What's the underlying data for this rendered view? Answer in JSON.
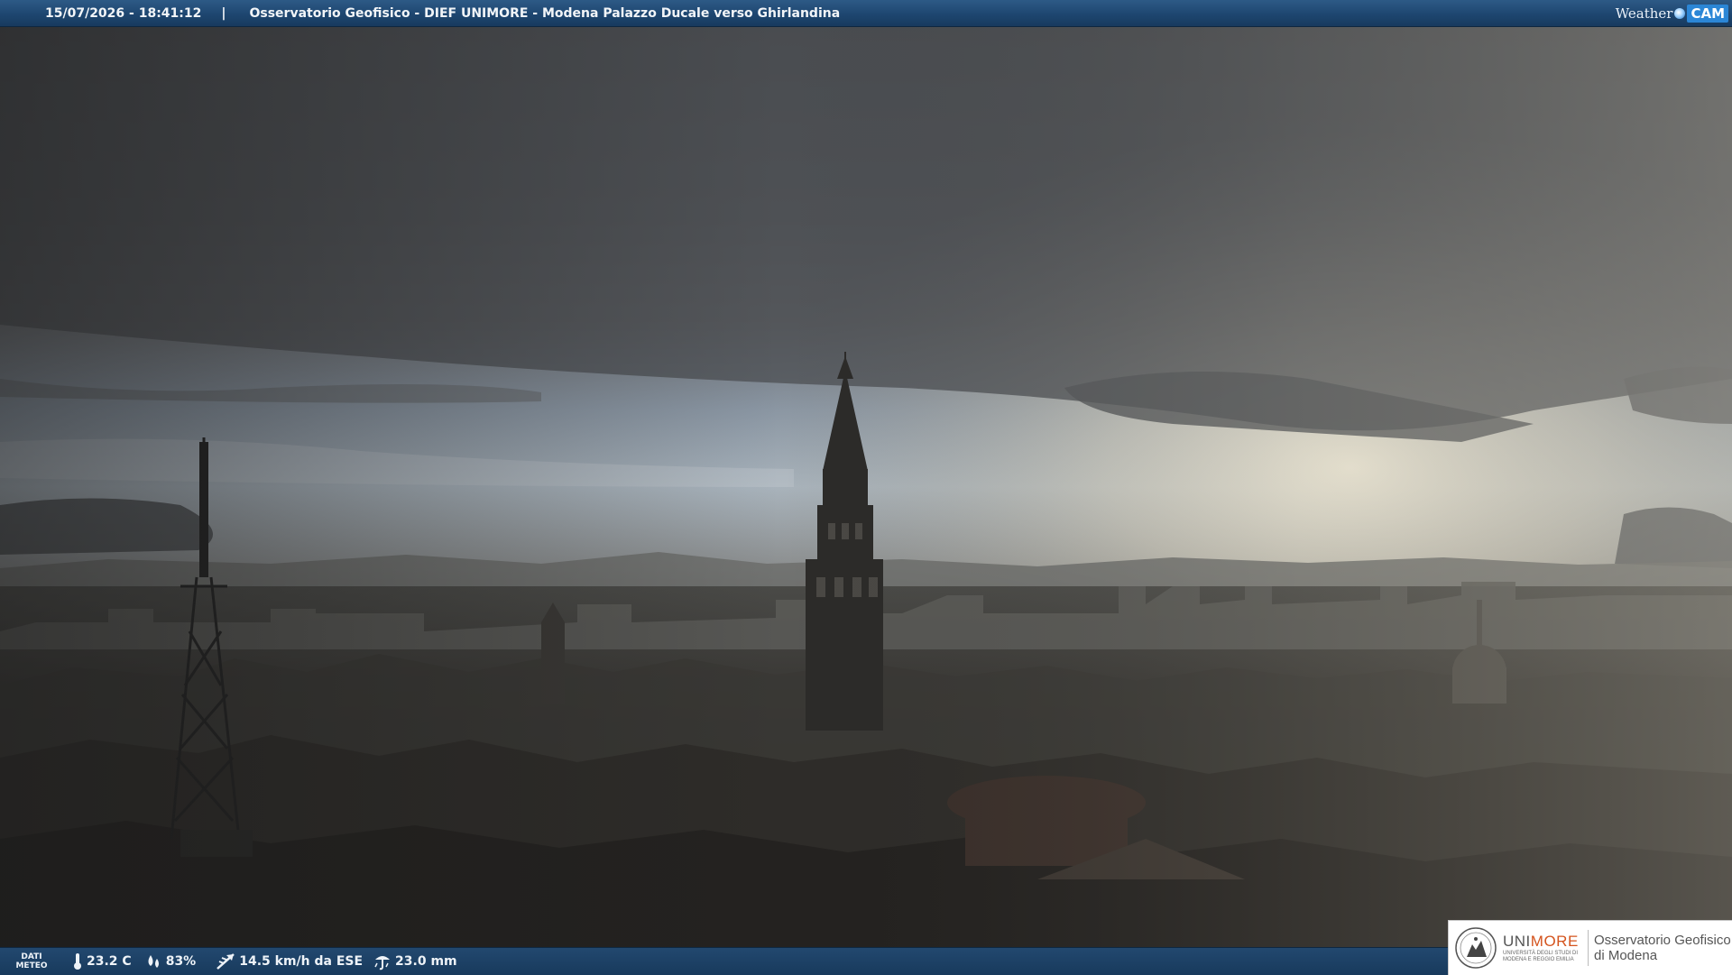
{
  "header": {
    "timestamp": "15/07/2026 - 18:41:12",
    "separator": "|",
    "title": "Osservatorio Geofisico - DIEF UNIMORE - Modena Palazzo Ducale verso Ghirlandina",
    "brand_weather": "Weather",
    "brand_cam": "CAM"
  },
  "meteo": {
    "label_line1": "DATI",
    "label_line2": "METEO",
    "temperature": "23.2 C",
    "humidity": "83%",
    "wind": "14.5 km/h da ESE",
    "rain": "23.0 mm"
  },
  "logo": {
    "uni": "UNI",
    "more": "MORE",
    "sub_line1": "UNIVERSITÀ DEGLI STUDI DI",
    "sub_line2": "MODENA E REGGIO EMILIA",
    "observatory_line1": "Osservatorio Geofisico",
    "observatory_line2": "di Modena"
  },
  "colors": {
    "bar_blue": "#1e4670",
    "unimore_orange": "#d4541e",
    "sky_light": "#f3ecd8"
  },
  "icons": [
    "thermometer-icon",
    "humidity-drops-icon",
    "wind-direction-icon",
    "rain-gauge-icon",
    "unimore-seal-icon",
    "weathercam-dot-icon"
  ]
}
